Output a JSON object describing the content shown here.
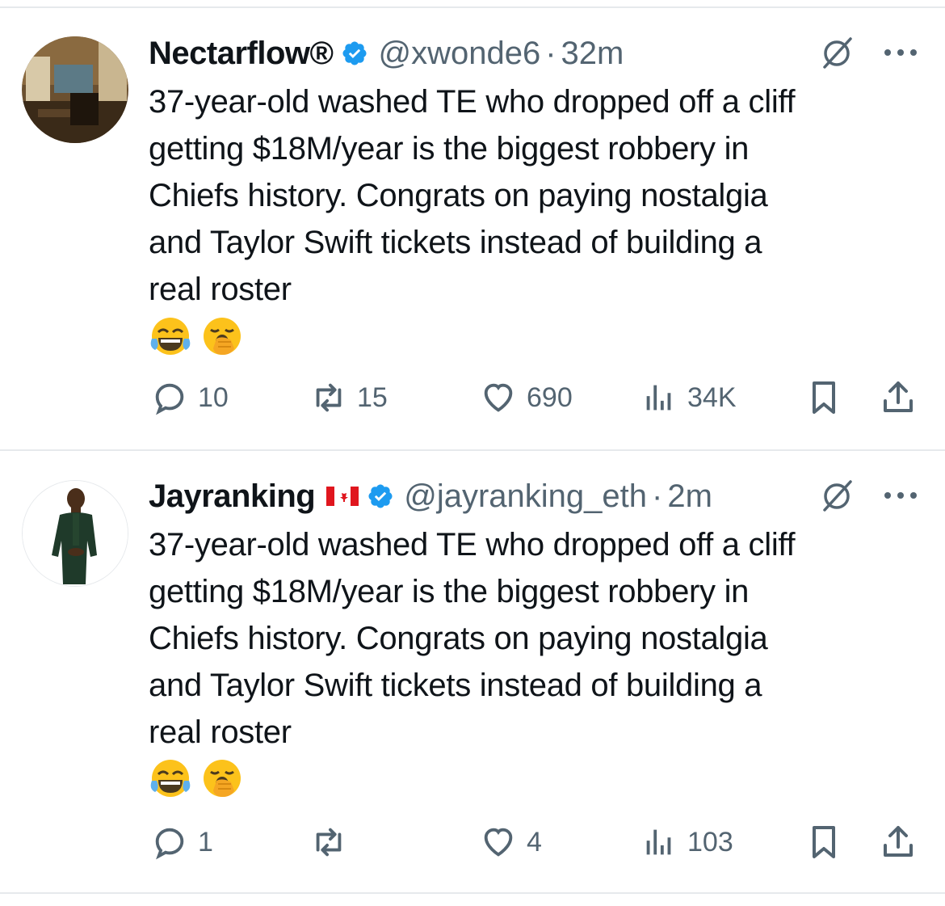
{
  "tweets": [
    {
      "name": "Nectarflow®",
      "handle": "@xwonde6",
      "dot": "·",
      "time": "32m",
      "text": "37-year-old washed TE who dropped off a cliff\ngetting $18M/year is the biggest robbery in\nChiefs history. Congrats on paying nostalgia\nand Taylor Swift tickets instead of building a\nreal roster",
      "emojis": [
        "face-with-tears-of-joy",
        "yawning-face"
      ],
      "replies": "10",
      "reposts": "15",
      "likes": "690",
      "views": "34K"
    },
    {
      "name": "Jayranking",
      "flag": "canada-flag",
      "handle": "@jayranking_eth",
      "dot": "·",
      "time": "2m",
      "text": "37-year-old washed TE who dropped off a cliff\ngetting $18M/year is the biggest robbery in\nChiefs history. Congrats on paying nostalgia\nand Taylor Swift tickets instead of building a\nreal roster",
      "emojis": [
        "face-with-tears-of-joy",
        "yawning-face"
      ],
      "replies": "1",
      "reposts": "",
      "likes": "4",
      "views": "103"
    }
  ],
  "colors": {
    "verified": "#1d9bf0",
    "muted": "#536471",
    "text": "#0f1419",
    "divider": "#e6e9ec"
  }
}
